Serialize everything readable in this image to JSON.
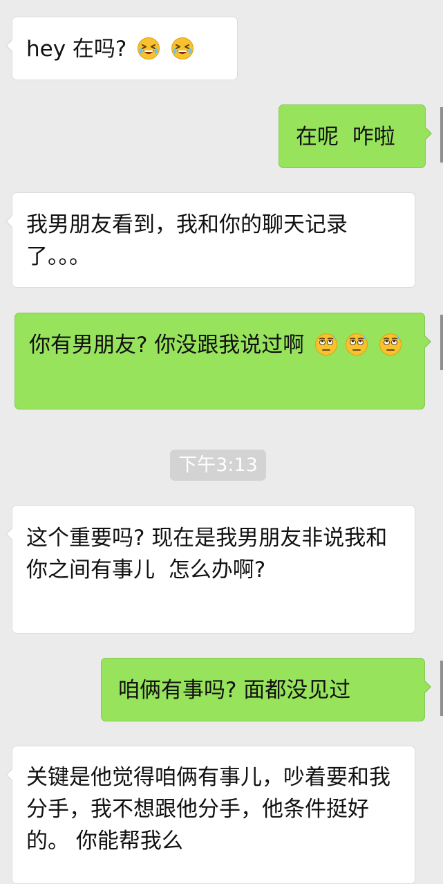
{
  "chat": {
    "timestamp": "下午3:13",
    "messages": [
      {
        "side": "received",
        "text": "hey 在吗?",
        "emojis": [
          "laughing-crying-emoji",
          "laughing-crying-emoji"
        ]
      },
      {
        "side": "sent",
        "text": "在呢  咋啦",
        "emojis": []
      },
      {
        "side": "received",
        "text": "我男朋友看到，我和你的聊天记录了。。。",
        "emojis": []
      },
      {
        "side": "sent",
        "text": "你有男朋友? 你没跟我说过啊",
        "emojis": [
          "sweat-eye-roll-emoji",
          "sweat-eye-roll-emoji",
          "sweat-eye-roll-emoji"
        ]
      },
      {
        "side": "received",
        "text": "这个重要吗? 现在是我男朋友非说我和你之间有事儿  怎么办啊?",
        "emojis": []
      },
      {
        "side": "sent",
        "text": "咱俩有事吗? 面都没见过",
        "emojis": []
      },
      {
        "side": "received",
        "text": "关键是他觉得咱俩有事儿，吵着要和我分手，我不想跟他分手，他条件挺好的。 你能帮我么",
        "emojis": []
      }
    ]
  },
  "colors": {
    "background": "#ebebeb",
    "received_bubble": "#ffffff",
    "sent_bubble": "#97e35c",
    "timestamp_pill": "#d3d3d3"
  }
}
